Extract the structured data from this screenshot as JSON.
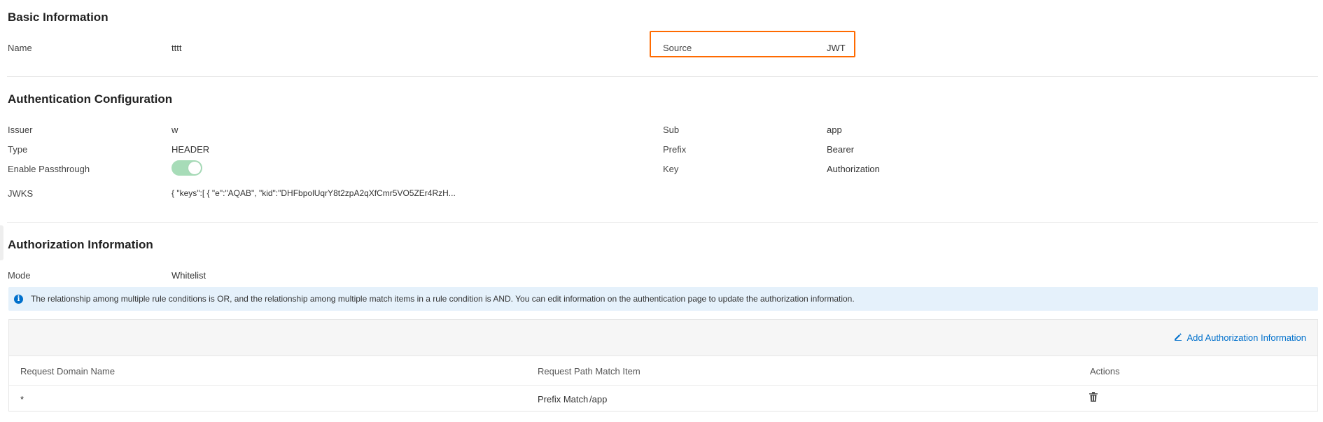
{
  "basic": {
    "title": "Basic Information",
    "name_label": "Name",
    "name_value": "tttt",
    "source_label": "Source",
    "source_value": "JWT"
  },
  "auth_config": {
    "title": "Authentication Configuration",
    "issuer_label": "Issuer",
    "issuer_value": "w",
    "sub_label": "Sub",
    "sub_value": "app",
    "type_label": "Type",
    "type_value": "HEADER",
    "prefix_label": "Prefix",
    "prefix_value": "Bearer",
    "passthrough_label": "Enable Passthrough",
    "passthrough_enabled": true,
    "key_label": "Key",
    "key_value": "Authorization",
    "jwks_label": "JWKS",
    "jwks_value": "{ \"keys\":[ { \"e\":\"AQAB\", \"kid\":\"DHFbpolUqrY8t2zpA2qXfCmr5VO5ZEr4RzH..."
  },
  "authz": {
    "title": "Authorization Information",
    "mode_label": "Mode",
    "mode_value": "Whitelist",
    "notice": "The relationship among multiple rule conditions is OR, and the relationship among multiple match items in a rule condition is AND. You can edit information on the authentication page to update the authorization information.",
    "add_label": "Add Authorization Information",
    "columns": [
      "Request Domain Name",
      "Request Path Match Item",
      "Actions"
    ],
    "rows": [
      {
        "domain": "*",
        "match_type": "Prefix Match",
        "path": "/app"
      }
    ]
  },
  "colors": {
    "highlight": "#ff6a00",
    "link": "#0070cc",
    "toggle_on": "#a7dcb8",
    "notice_bg": "#e5f1fb"
  },
  "icons": [
    "info-icon",
    "edit-icon",
    "trash-icon"
  ]
}
